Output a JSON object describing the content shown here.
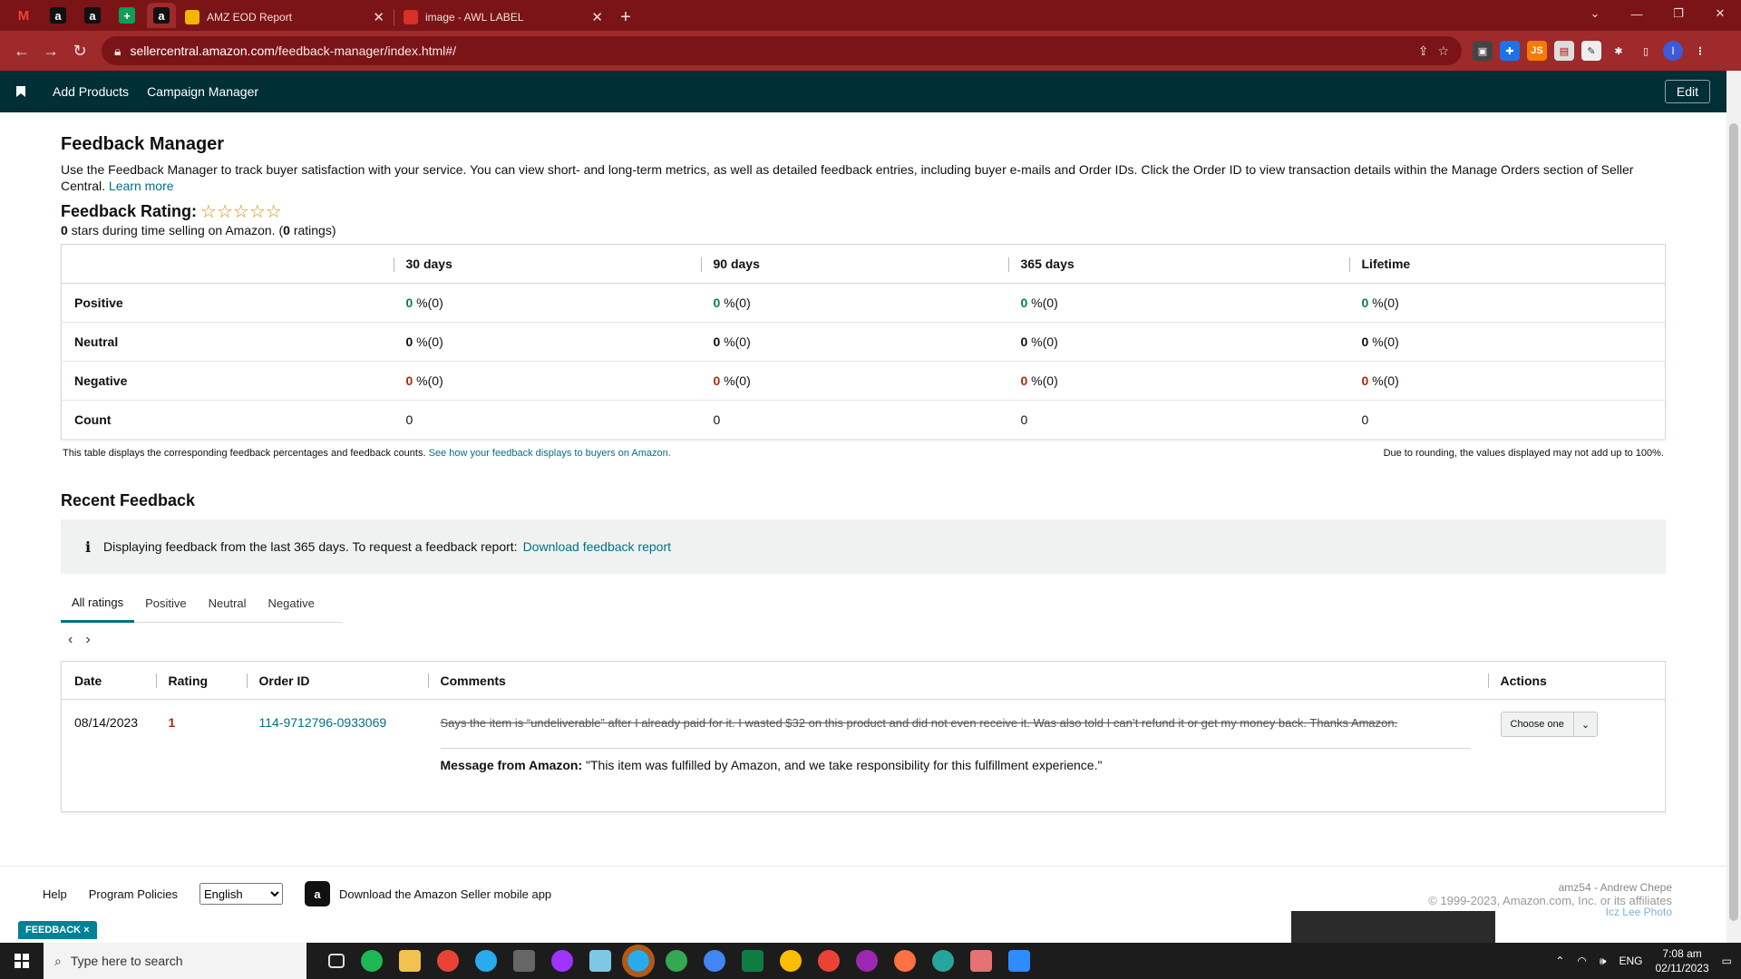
{
  "browser": {
    "tabs": [
      {
        "title": "AMZ EOD Report",
        "color": "#f4b400"
      },
      {
        "title": "image - AWL LABEL",
        "color": "#d93025"
      }
    ],
    "address": {
      "domain": "sellercentral.amazon.com",
      "path": "/feedback-manager/index.html#/"
    }
  },
  "nav": {
    "add_products": "Add Products",
    "campaign_manager": "Campaign Manager",
    "edit": "Edit"
  },
  "page": {
    "title": "Feedback Manager",
    "description": "Use the Feedback Manager to track buyer satisfaction with your service. You can view short- and long-term metrics, as well as detailed feedback entries, including buyer e-mails and Order IDs. Click the Order ID to view transaction details within the Manage Orders section of Seller Central.",
    "learn_more": "Learn more",
    "rating_label": "Feedback Rating:",
    "stars": "☆☆☆☆☆",
    "rating_stars_count": "0",
    "rating_sub_mid": " stars during time selling on Amazon. (",
    "rating_count": "0",
    "rating_sub_end": " ratings)"
  },
  "metrics": {
    "columns": [
      "30 days",
      "90 days",
      "365 days",
      "Lifetime"
    ],
    "rows": [
      {
        "label": "Positive",
        "kind": "pos",
        "cells": [
          {
            "n": "0",
            "s": " %(0)"
          },
          {
            "n": "0",
            "s": " %(0)"
          },
          {
            "n": "0",
            "s": " %(0)"
          },
          {
            "n": "0",
            "s": " %(0)"
          }
        ]
      },
      {
        "label": "Neutral",
        "kind": "neu",
        "cells": [
          {
            "n": "0",
            "s": " %(0)"
          },
          {
            "n": "0",
            "s": " %(0)"
          },
          {
            "n": "0",
            "s": " %(0)"
          },
          {
            "n": "0",
            "s": " %(0)"
          }
        ]
      },
      {
        "label": "Negative",
        "kind": "neg",
        "cells": [
          {
            "n": "0",
            "s": " %(0)"
          },
          {
            "n": "0",
            "s": " %(0)"
          },
          {
            "n": "0",
            "s": " %(0)"
          },
          {
            "n": "0",
            "s": " %(0)"
          }
        ]
      },
      {
        "label": "Count",
        "kind": "cnt",
        "cells": [
          {
            "n": "0",
            "s": ""
          },
          {
            "n": "0",
            "s": ""
          },
          {
            "n": "0",
            "s": ""
          },
          {
            "n": "0",
            "s": ""
          }
        ]
      }
    ],
    "note_left": "This table displays the corresponding feedback percentages and feedback counts.",
    "note_link": "See how your feedback displays to buyers on Amazon.",
    "note_right": "Due to rounding, the values displayed may not add up to 100%."
  },
  "recent": {
    "title": "Recent Feedback",
    "info_text": "Displaying feedback from the last 365 days. To request a feedback report:",
    "info_link": "Download feedback report",
    "tabs": [
      "All ratings",
      "Positive",
      "Neutral",
      "Negative"
    ],
    "columns": [
      "Date",
      "Rating",
      "Order ID",
      "Comments",
      "Actions"
    ],
    "entry": {
      "date": "08/14/2023",
      "rating": "1",
      "order_id": "114-9712796-0933069",
      "comment": "Says the item is “undeliverable” after I already paid for it. I wasted $32 on this product and did not even receive it. Was also told I can’t refund it or get my money back. Thanks Amazon.",
      "amazon_label": "Message from Amazon:",
      "amazon_msg": " \"This item was fulfilled by Amazon, and we take responsibility for this fulfillment experience.\"",
      "action": "Choose one"
    }
  },
  "footer": {
    "help": "Help",
    "policies": "Program Policies",
    "language": "English",
    "app": "Download the Amazon Seller mobile app",
    "copyright": "© 1999-2023, Amazon.com, Inc. or its affiliates",
    "user": "amz54 - Andrew Chepe",
    "photo": "Icz Lee Photo",
    "feedback_badge": "FEEDBACK ×"
  },
  "taskbar": {
    "search_placeholder": "Type here to search",
    "time": "7:08 am",
    "date": "02/11/2023",
    "lang": "ENG"
  }
}
